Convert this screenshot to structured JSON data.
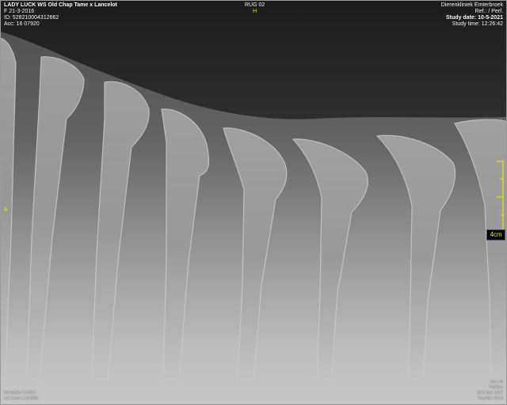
{
  "patient": {
    "name_line": "LADY LUCK WS  Old Chap Tame x Lancelot",
    "birth_line": "F  21-3-2016",
    "id_line": "ID: 528210004312662",
    "acc_line": "Acc: 16 07920"
  },
  "series": {
    "label": "RUG 02",
    "orientation_marker": "H"
  },
  "study": {
    "clinic": "Dierenkliniek Emterbroek",
    "ref_line": "Ref.: / Perf.",
    "date_line": "Study date: 10-5-2021",
    "time_line": "Study time: 12:26:42"
  },
  "side_marker": "A",
  "scale": {
    "label": "4cm"
  },
  "footer": {
    "left_line1": "W=28545 C=3617",
    "left_line2": "1/1 Zoom: 110.00%",
    "right_line1": "Hor: 4k",
    "right_line2": "Position",
    "right_line3": "1047 Sel: 1047",
    "right_line4": "Pos/Slic: 0/0:0"
  },
  "colors": {
    "overlay_text": "#ffffff",
    "marker": "#f5e800",
    "background_dark": "#222222"
  }
}
